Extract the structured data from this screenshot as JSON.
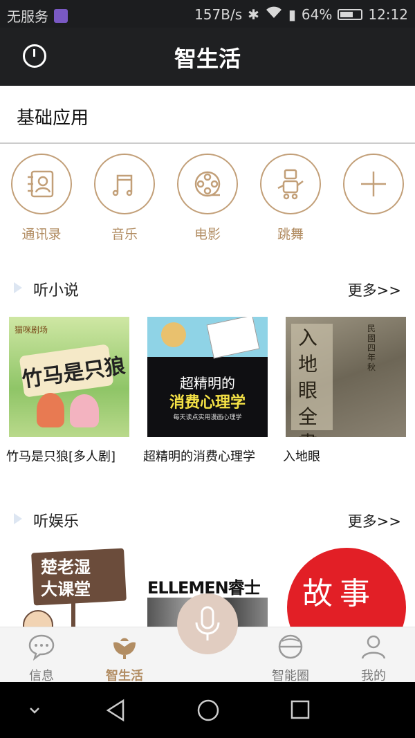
{
  "status_bar": {
    "carrier": "无服务",
    "speed": "157B/s",
    "battery": "64%",
    "battery_level": 0.64,
    "time": "12:12"
  },
  "header": {
    "title": "智生活"
  },
  "basic_apps": {
    "label": "基础应用",
    "items": [
      {
        "label": "通讯录",
        "icon": "contacts-icon"
      },
      {
        "label": "音乐",
        "icon": "music-icon"
      },
      {
        "label": "电影",
        "icon": "film-reel-icon"
      },
      {
        "label": "跳舞",
        "icon": "dance-robot-icon"
      },
      {
        "label": "",
        "icon": "add-icon"
      }
    ]
  },
  "novels": {
    "title": "听小说",
    "more": "更多>>",
    "items": [
      {
        "title": "竹马是只狼[多人剧]",
        "cover_text": "竹马是只狼",
        "cover_caption": "猫咪剧场"
      },
      {
        "title": "超精明的消费心理学",
        "cover_text": "超精明的",
        "cover_text2": "消费心理学",
        "cover_caption": "每天读点实用漫画心理学"
      },
      {
        "title": "入地眼",
        "cover_text": "入地眼全書",
        "cover_caption": "民國四年秋"
      }
    ]
  },
  "entertainment": {
    "title": "听娱乐",
    "more": "更多>>",
    "items": [
      {
        "cover_text": "楚老湿",
        "cover_text2": "大课堂"
      },
      {
        "cover_text": "ELLEMEN睿士"
      },
      {
        "cover_text": "故事"
      }
    ]
  },
  "tabbar": {
    "tabs": [
      {
        "label": "信息",
        "icon": "chat-bubble-icon"
      },
      {
        "label": "智生活",
        "icon": "lotus-icon"
      },
      {
        "label": "智能圈",
        "icon": "globe-icon"
      },
      {
        "label": "我的",
        "icon": "user-icon"
      }
    ]
  },
  "colors": {
    "accent": "#b28d63",
    "header_bg": "#1f2022",
    "mic_bg": "#e1cdc1"
  }
}
